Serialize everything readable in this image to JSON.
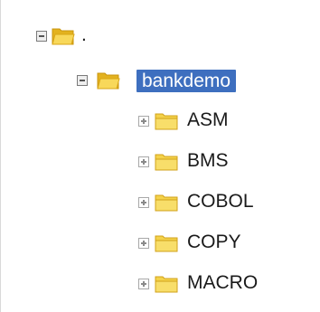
{
  "tree": {
    "root": {
      "label": ".",
      "expanded": true,
      "icon": "folder-open-icon",
      "children": [
        {
          "label": "bankdemo",
          "expanded": true,
          "selected": true,
          "icon": "folder-open-icon",
          "children": [
            {
              "label": "ASM",
              "expanded": false,
              "icon": "folder-closed-icon"
            },
            {
              "label": "BMS",
              "expanded": false,
              "icon": "folder-closed-icon"
            },
            {
              "label": "COBOL",
              "expanded": false,
              "icon": "folder-closed-icon"
            },
            {
              "label": "COPY",
              "expanded": false,
              "icon": "folder-closed-icon"
            },
            {
              "label": "MACRO",
              "expanded": false,
              "icon": "folder-closed-icon"
            }
          ]
        }
      ]
    }
  },
  "colors": {
    "selection": "#3e6fbf",
    "folder_yellow": "#f4d24a",
    "text": "#1a1a1a"
  }
}
